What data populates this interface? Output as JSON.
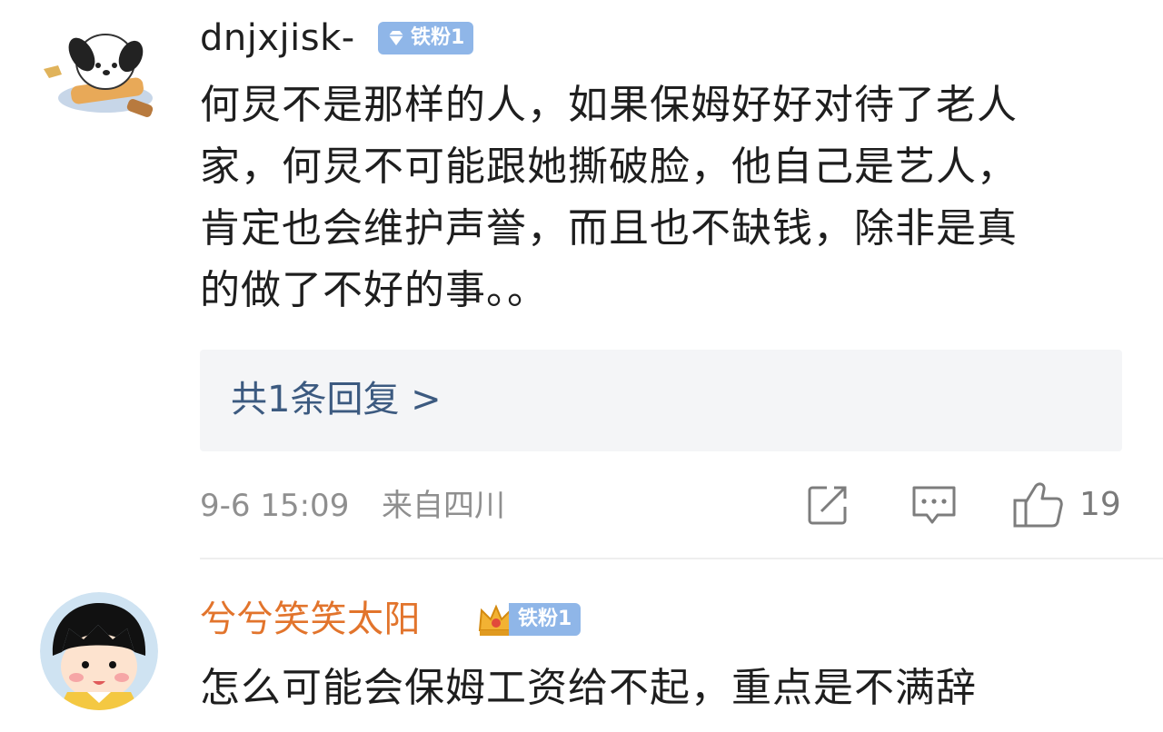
{
  "colors": {
    "badge_bg": "#8fb6e8",
    "reply_link": "#3c5a80",
    "meta_text": "#8f8f8f",
    "orange_username": "#e2742c"
  },
  "comments": [
    {
      "username": "dnjxjisk-",
      "badge": {
        "icon": "diamond-icon",
        "label": "铁粉1"
      },
      "avatar": "pochacco-avatar",
      "body_lines": [
        "何炅不是那样的人，如果保姆好好对待了老人",
        "家，何炅不可能跟她撕破脸，他自己是艺人，",
        "肯定也会维护声誉，而且也不缺钱，除非是真",
        "的做了不好的事。。"
      ],
      "replies_label": "共1条回复 >",
      "timestamp": "9-6 15:09",
      "location": "来自四川",
      "actions": {
        "share_icon": "share-icon",
        "comment_icon": "comment-icon",
        "like_icon": "thumbs-up-icon",
        "like_count": "19"
      }
    },
    {
      "username": "兮兮笑笑太阳",
      "badge": {
        "icon": "crown-icon",
        "label": "铁粉1"
      },
      "avatar": "chibi-maruko-avatar",
      "body_lines": [
        "怎么可能会保姆工资给不起，重点是不满辞"
      ]
    }
  ]
}
